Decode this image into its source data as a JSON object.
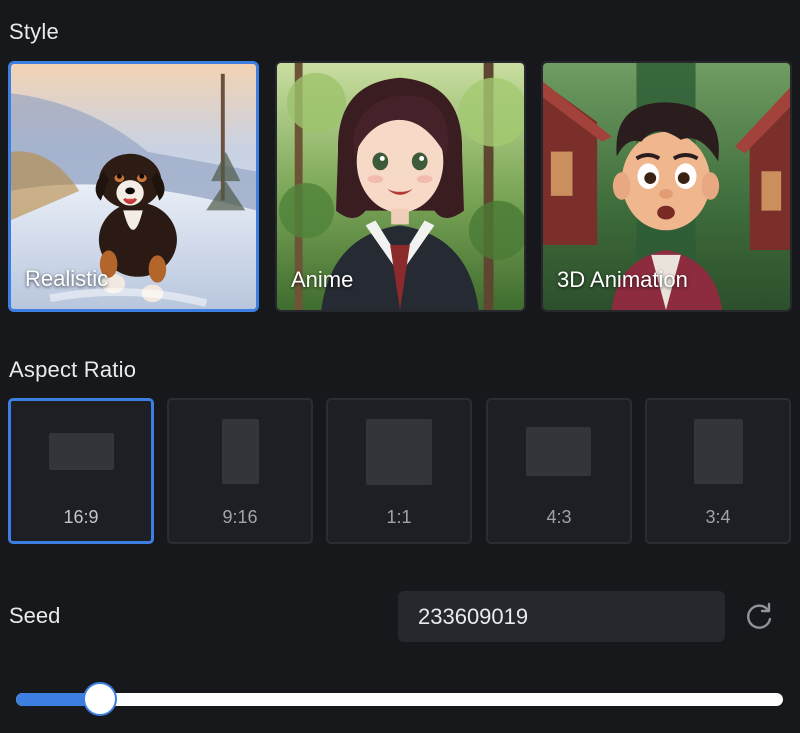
{
  "style_section": {
    "title": "Style",
    "cards": [
      {
        "label": "Realistic",
        "selected": true,
        "image_icon": "dog-running-snow-image"
      },
      {
        "label": "Anime",
        "selected": false,
        "image_icon": "anime-girl-forest-image"
      },
      {
        "label": "3D Animation",
        "selected": false,
        "image_icon": "cartoon-boy-houses-image"
      }
    ]
  },
  "aspect_section": {
    "title": "Aspect Ratio",
    "options": [
      {
        "label": "16:9",
        "selected": true
      },
      {
        "label": "9:16",
        "selected": false
      },
      {
        "label": "1:1",
        "selected": false
      },
      {
        "label": "4:3",
        "selected": false
      },
      {
        "label": "3:4",
        "selected": false
      }
    ]
  },
  "seed": {
    "label": "Seed",
    "value": "233609019",
    "refresh_icon": "refresh-icon"
  },
  "slider": {
    "value_fraction": 0.11
  },
  "colors": {
    "accent": "#3d7fe0",
    "background": "#17181c",
    "tile": "#1e1f24",
    "input": "#26282d"
  }
}
